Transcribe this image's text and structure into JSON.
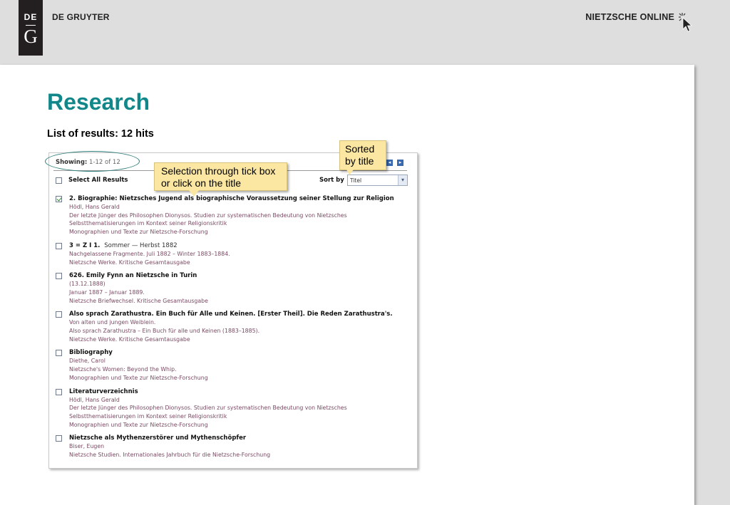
{
  "header": {
    "logo_de": "DE",
    "logo_g": "G",
    "brand": "DE GRUYTER",
    "product": "NIETZSCHE ONLINE",
    "product_icon": "cursor-click-icon"
  },
  "slide": {
    "title": "Research",
    "subtitle": "List of results: 12 hits"
  },
  "results_panel": {
    "showing_label": "Showing:",
    "showing_range": "1-12 of 12",
    "pager_prev_icon": "pager-prev-icon",
    "pager_next_icon": "pager-next-icon",
    "select_all_label": "Select All Results",
    "sort_label": "Sort by",
    "sort_value": "Titel",
    "items": [
      {
        "checked": true,
        "title": "2. Biographie: Nietzsches Jugend als biographische Voraussetzung seiner Stellung zur Religion",
        "title_extra": "",
        "lines": [
          "Hödl, Hans Gerald",
          "Der letzte Jünger des Philosophen Dionysos. Studien zur systematischen Bedeutung von Nietzsches",
          "Selbstthematisierungen im Kontext seiner Religionskritik",
          "Monographien und Texte zur Nietzsche-Forschung"
        ]
      },
      {
        "checked": false,
        "title": "3 = Z I 1.",
        "title_extra": "Sommer — Herbst 1882",
        "lines": [
          "Nachgelassene Fragmente. Juli 1882 – Winter 1883–1884.",
          "Nietzsche Werke. Kritische Gesamtausgabe"
        ]
      },
      {
        "checked": false,
        "title": "626. Emily Fynn an Nietzsche in Turin",
        "title_extra": "",
        "lines": [
          "(13.12.1888)",
          "Januar 1887 – Januar 1889.",
          "Nietzsche Briefwechsel. Kritische Gesamtausgabe"
        ]
      },
      {
        "checked": false,
        "title": "Also sprach Zarathustra. Ein Buch für Alle und Keinen. [Erster Theil]. Die Reden Zarathustra's.",
        "title_extra": "",
        "lines": [
          " Von alten und jungen Weiblein.",
          "Also sprach Zarathustra – Ein Buch für alle und Keinen (1883–1885).",
          "Nietzsche Werke. Kritische Gesamtausgabe"
        ]
      },
      {
        "checked": false,
        "title": "Bibliography",
        "title_extra": "",
        "lines": [
          "Diethe, Carol",
          "Nietzsche's Women: Beyond the Whip.",
          "Monographien und Texte zur Nietzsche-Forschung"
        ]
      },
      {
        "checked": false,
        "title": "Literaturverzeichnis",
        "title_extra": "",
        "lines": [
          "Hödl, Hans Gerald",
          "Der letzte Jünger des Philosophen Dionysos. Studien zur systematischen Bedeutung von Nietzsches",
          "Selbstthematisierungen im Kontext seiner Religionskritik",
          "Monographien und Texte zur Nietzsche-Forschung"
        ]
      },
      {
        "checked": false,
        "title": "Nietzsche als Mythenzerstörer und Mythenschöpfer",
        "title_extra": "",
        "lines": [
          "Biser, Eugen",
          "Nietzsche Studien. Internationales Jahrbuch für die Nietzsche-Forschung"
        ]
      }
    ]
  },
  "callouts": {
    "selection": "Selection through tick box or click on the title",
    "sort": "Sorted by title"
  },
  "colors": {
    "accent_teal": "#12878a",
    "callout_bg": "#fbe6a2",
    "meta_text": "#7a4a63"
  }
}
